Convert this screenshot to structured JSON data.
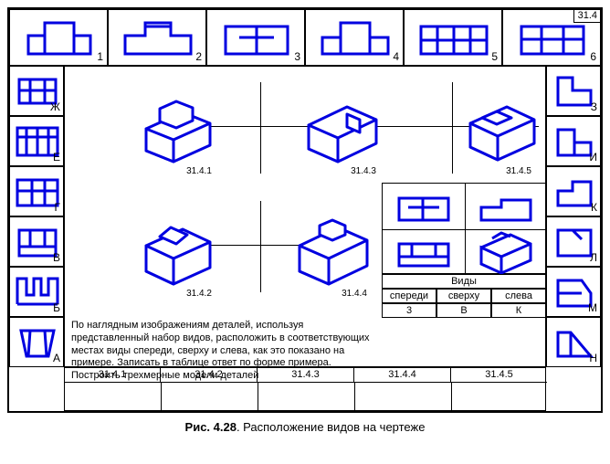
{
  "tag": "31.4",
  "caption_bold": "Рис. 4.28",
  "caption_rest": ". Расположение видов на чертеже",
  "top_nums": [
    "1",
    "2",
    "3",
    "4",
    "5",
    "6"
  ],
  "left_letters": [
    "Ж",
    "Е",
    "Г",
    "В",
    "Б",
    "А"
  ],
  "right_letters": [
    "З",
    "И",
    "К",
    "Л",
    "М",
    "Н"
  ],
  "iso_labels": [
    "31.4.1",
    "31.4.3",
    "31.4.5",
    "31.4.2",
    "31.4.4"
  ],
  "bottom_cells": [
    "31.4.1",
    "31.4.2",
    "31.4.3",
    "31.4.4",
    "31.4.5"
  ],
  "views_title": "Виды",
  "views_headers": [
    "спереди",
    "сверху",
    "слева"
  ],
  "views_example": [
    "3",
    "В",
    "К"
  ],
  "task_text": "По наглядным изображениям деталей, используя представленный набор видов, расположить в соответствующих местах виды спереди, сверху и слева, как это показано на примере. Записать в таблице ответ по форме примера. Построить трехмерные модели деталей",
  "chart_data": {
    "type": "table",
    "description": "Engineering drawing exercise: match isometric parts 31.4.1–31.4.5 to their front/top/left orthographic views chosen from labeled cells",
    "top_views_numbered": [
      1,
      2,
      3,
      4,
      5,
      6
    ],
    "left_views_lettered": [
      "Ж",
      "Е",
      "Г",
      "В",
      "Б",
      "А"
    ],
    "right_views_lettered": [
      "З",
      "И",
      "К",
      "Л",
      "М",
      "Н"
    ],
    "isometric_parts": [
      "31.4.1",
      "31.4.2",
      "31.4.3",
      "31.4.4",
      "31.4.5"
    ],
    "answer_columns": [
      "спереди",
      "сверху",
      "слева"
    ],
    "example_row": {
      "part": "31.4.5",
      "спереди": "3",
      "сверху": "В",
      "слева": "К"
    }
  }
}
